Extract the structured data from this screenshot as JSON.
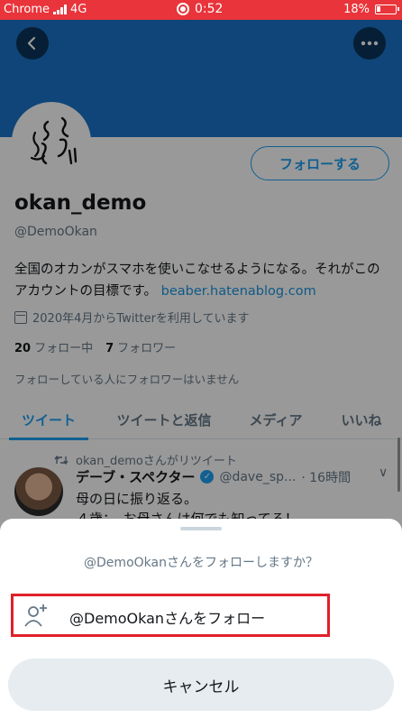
{
  "status_bar": {
    "app": "Chrome",
    "network": "4G",
    "time": "0:52",
    "battery": "18%"
  },
  "header": {
    "back_icon": "back-arrow-icon",
    "more_icon": "more-horizontal-icon"
  },
  "profile": {
    "follow_button": "フォローする",
    "display_name": "okan_demo",
    "handle": "@DemoOkan",
    "bio_text": "全国のオカンがスマホを使いこなせるようになる。それがこのアカウントの目標です。",
    "bio_link": "beaber.hatenablog.com",
    "joined": "2020年4月からTwitterを利用しています",
    "following_count": "20",
    "following_label": "フォロー中",
    "followers_count": "7",
    "followers_label": "フォロワー",
    "no_mutual": "フォローしている人にフォロワーはいません"
  },
  "tabs": [
    {
      "label": "ツイート",
      "active": true
    },
    {
      "label": "ツイートと返信",
      "active": false
    },
    {
      "label": "メディア",
      "active": false
    },
    {
      "label": "いいね",
      "active": false
    }
  ],
  "tweet": {
    "retweet_line": "okan_demoさんがリツイート",
    "author": "デーブ・スペクター",
    "author_handle": "@dave_sp...",
    "time": "· 16時間",
    "line1": "母の日に振り返る。",
    "line2": "４歳：　お母さんは何でも知ってる！"
  },
  "sheet": {
    "prompt": "@DemoOkanさんをフォローしますか？",
    "follow_action": "@DemoOkanさんをフォロー",
    "cancel": "キャンセル"
  },
  "colors": {
    "accent": "#1da1f2",
    "status_bar": "#e8343a",
    "highlight": "#e0202a"
  }
}
